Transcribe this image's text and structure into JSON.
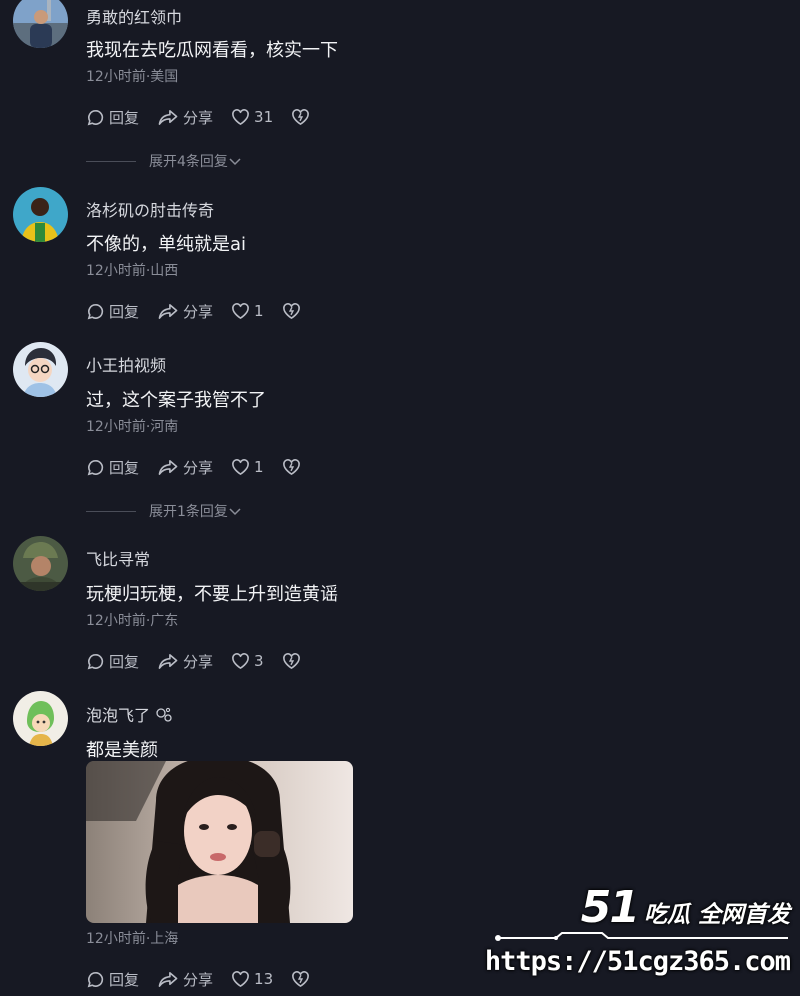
{
  "comments": [
    {
      "username": "勇敢的红领巾",
      "text": "我现在去吃瓜网看看，核实一下",
      "time": "12小时前",
      "location": "美国",
      "reply_label": "回复",
      "share_label": "分享",
      "likes": "31"
    },
    {
      "username": "洛杉矶の肘击传奇",
      "text": "不像的，单纯就是ai",
      "time": "12小时前",
      "location": "山西",
      "reply_label": "回复",
      "share_label": "分享",
      "likes": "1"
    },
    {
      "username": "小王拍视频",
      "text": "过，这个案子我管不了",
      "time": "12小时前",
      "location": "河南",
      "reply_label": "回复",
      "share_label": "分享",
      "likes": "1"
    },
    {
      "username": "飞比寻常",
      "text": "玩梗归玩梗，不要上升到造黄谣",
      "time": "12小时前",
      "location": "广东",
      "reply_label": "回复",
      "share_label": "分享",
      "likes": "3"
    },
    {
      "username": "泡泡飞了",
      "text": "都是美颜",
      "time": "12小时前",
      "location": "上海",
      "reply_label": "回复",
      "share_label": "分享",
      "likes": "13"
    }
  ],
  "expand_replies": [
    {
      "label": "展开4条回复"
    },
    {
      "label": "展开1条回复"
    }
  ],
  "meta_separator": "·",
  "watermark": {
    "brand_num": "51",
    "brand_text": "吃瓜 全网首发",
    "url": "https://51cgz365.com"
  },
  "colors": {
    "background": "#171923",
    "text": "#f2f3f5",
    "muted": "#8a8d98"
  }
}
